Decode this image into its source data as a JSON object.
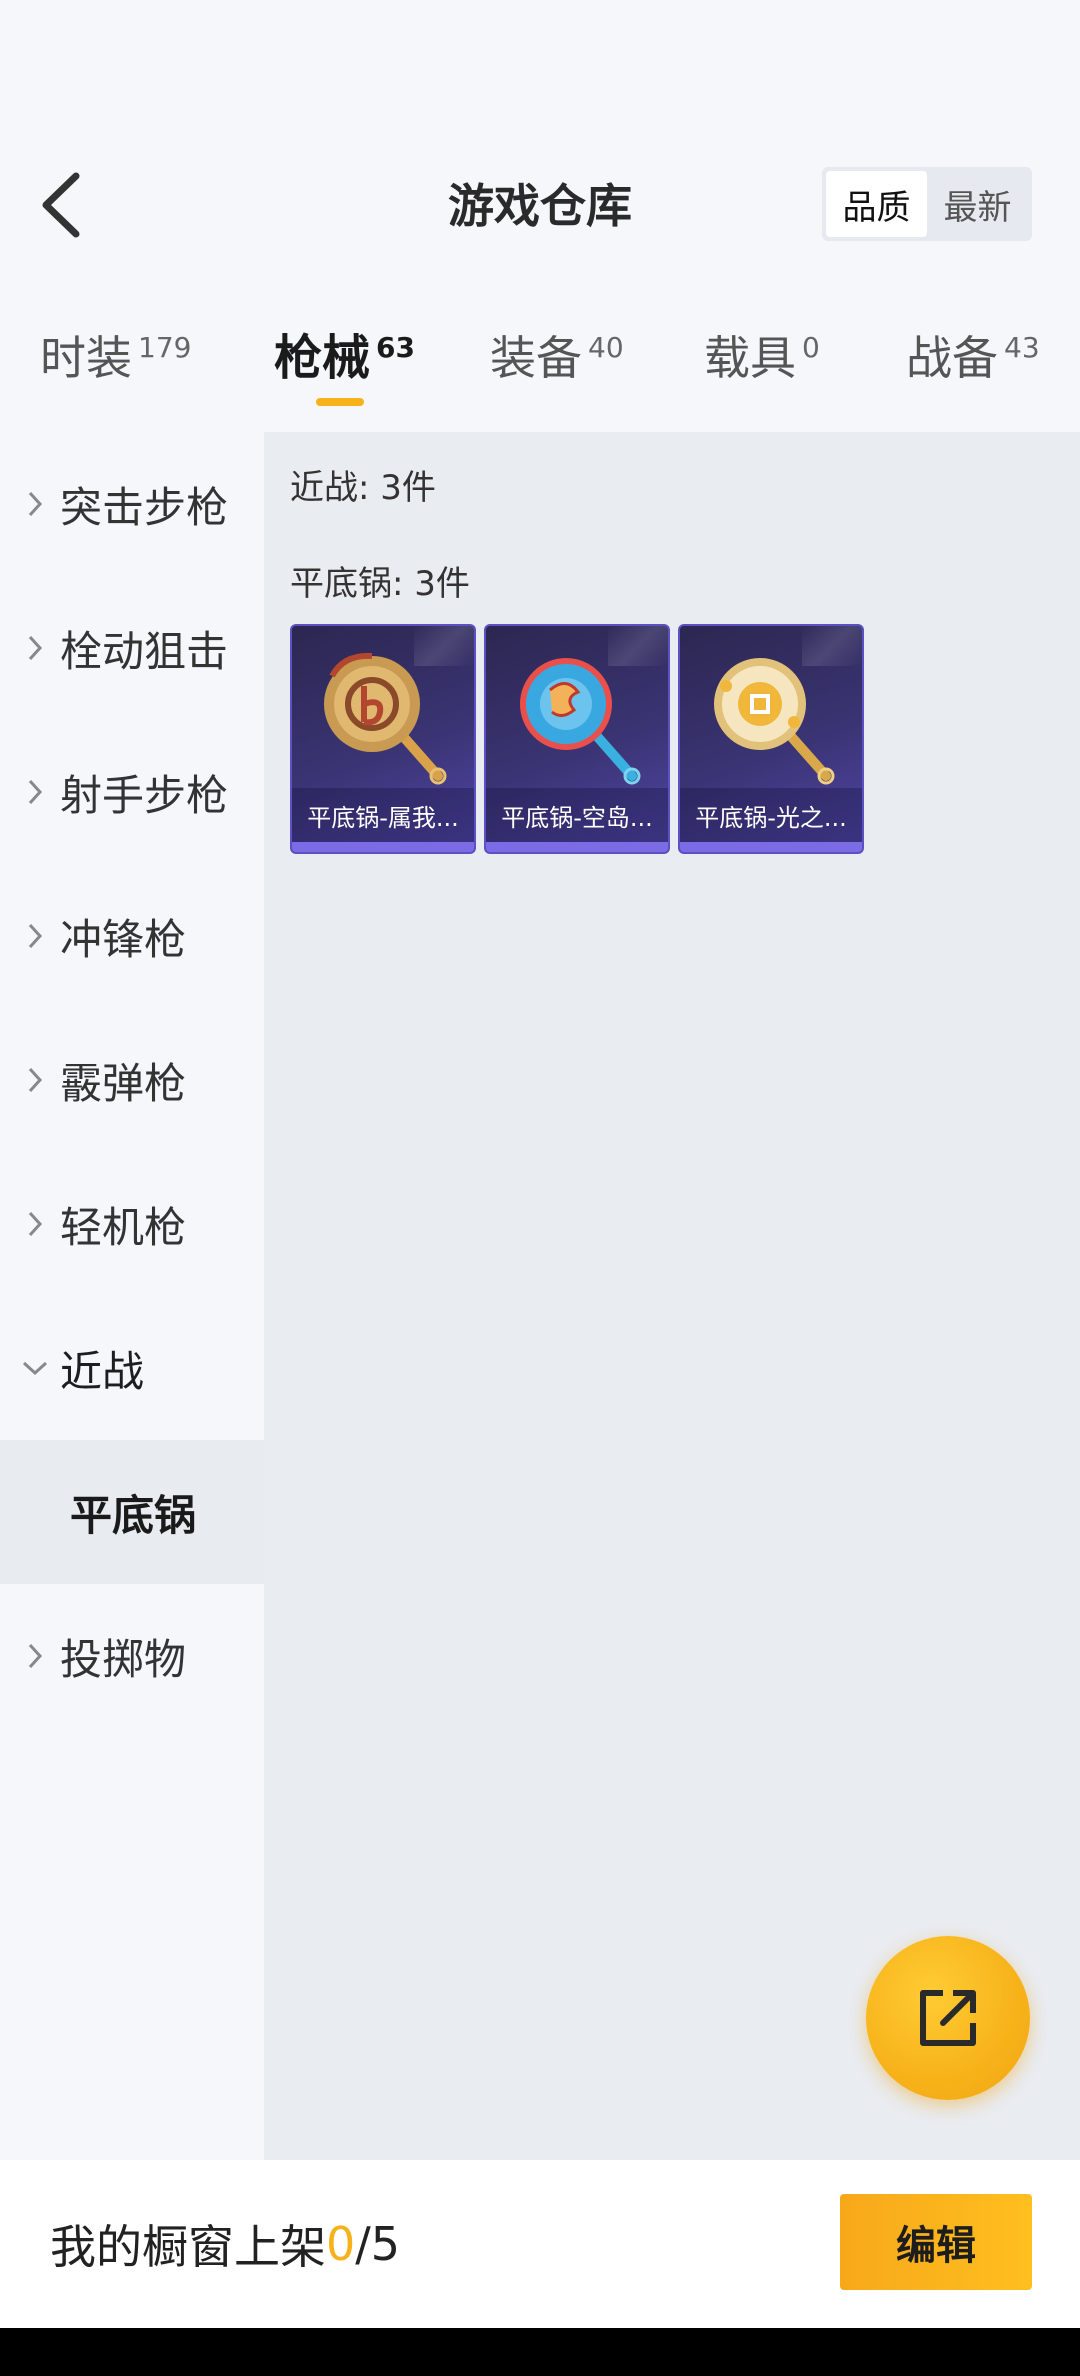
{
  "header": {
    "title": "游戏仓库",
    "sort_options": [
      {
        "label": "品质",
        "active": true
      },
      {
        "label": "最新",
        "active": false
      }
    ]
  },
  "tabs": [
    {
      "label": "时装",
      "count": "179",
      "active": false
    },
    {
      "label": "枪械",
      "count": "63",
      "active": true
    },
    {
      "label": "装备",
      "count": "40",
      "active": false
    },
    {
      "label": "载具",
      "count": "0",
      "active": false
    },
    {
      "label": "战备",
      "count": "43",
      "active": false
    }
  ],
  "sidebar": {
    "items": [
      {
        "label": "突击步枪",
        "expanded": false
      },
      {
        "label": "栓动狙击",
        "expanded": false
      },
      {
        "label": "射手步枪",
        "expanded": false
      },
      {
        "label": "冲锋枪",
        "expanded": false
      },
      {
        "label": "霰弹枪",
        "expanded": false
      },
      {
        "label": "轻机枪",
        "expanded": false
      },
      {
        "label": "近战",
        "expanded": true
      },
      {
        "label": "投掷物",
        "expanded": false
      }
    ],
    "sub_item": {
      "label": "平底锅",
      "selected": true
    }
  },
  "content": {
    "category_summary": "近战: 3件",
    "subcategory_summary": "平底锅: 3件",
    "items": [
      {
        "name": "平底锅-属我...",
        "icon": "frying-pan-gold-icon"
      },
      {
        "name": "平底锅-空岛...",
        "icon": "frying-pan-blue-icon"
      },
      {
        "name": "平底锅-光之...",
        "icon": "frying-pan-cream-icon"
      }
    ]
  },
  "fab": {
    "icon": "share-external-icon"
  },
  "bottom_bar": {
    "label": "我的橱窗上架 ",
    "current": "0",
    "total": "/5",
    "edit_label": "编辑"
  },
  "colors": {
    "accent": "#f7b21a",
    "card_bg": "#3a3474",
    "page_bg": "#f5f7fb",
    "content_bg": "#e9ecf1"
  }
}
